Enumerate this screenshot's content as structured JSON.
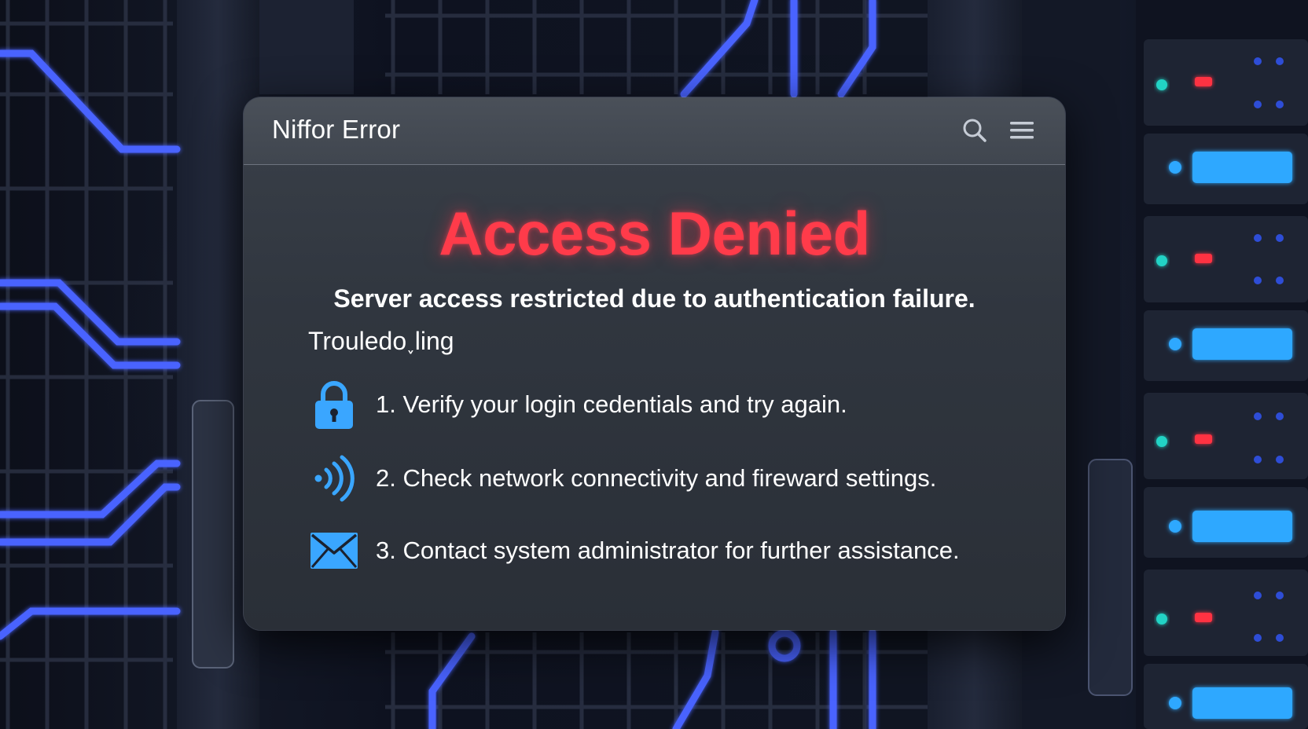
{
  "window": {
    "title": "Niffor Error",
    "search_icon": "search-icon",
    "menu_icon": "hamburger-menu-icon"
  },
  "error": {
    "heading": "Access Denied",
    "message": "Server access restricted due to authentication failure.",
    "section_label": "Trouledo˯ling",
    "heading_color": "#ff3b4a"
  },
  "steps": [
    {
      "icon": "lock-icon",
      "text": "1. Verify your login cedentials and try again."
    },
    {
      "icon": "wireless-signal-icon",
      "text": "2. Check network connectivity and fireward settings."
    },
    {
      "icon": "envelope-icon",
      "text": "3. Contact system administrator for further assistance."
    }
  ],
  "colors": {
    "accent_blue": "#3aa6ff",
    "circuit_blue": "#4a63ff",
    "window_bg": "#343a42"
  }
}
